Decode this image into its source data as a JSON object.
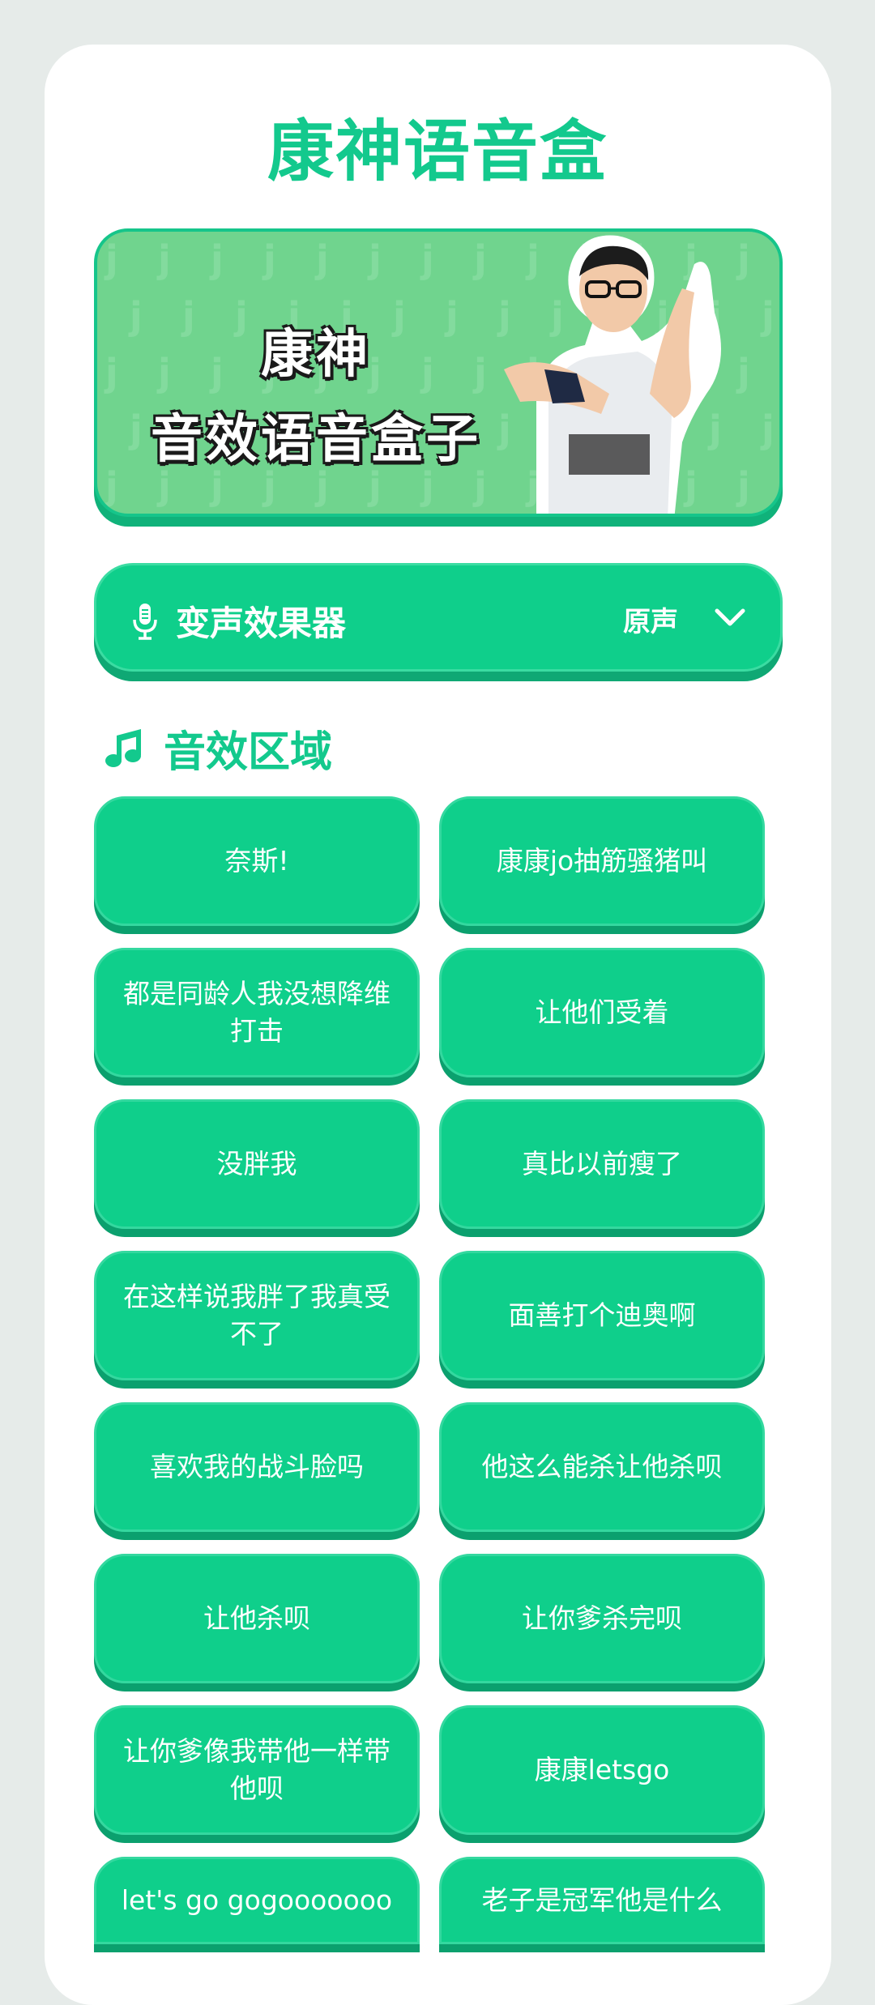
{
  "app": {
    "title": "康神语音盒"
  },
  "banner": {
    "line1": "康神",
    "line2": "音效语音盒子"
  },
  "voice_changer": {
    "label": "变声效果器",
    "value": "原声",
    "icon": "microphone-icon",
    "dropdown_icon": "chevron-down-icon"
  },
  "section": {
    "label": "音效区域",
    "icon": "music-note-icon"
  },
  "colors": {
    "accent": "#13c98d",
    "button": "#0fcf8b",
    "banner": "#70d48e"
  },
  "sounds": [
    "奈斯!",
    "康康jo抽筋骚猪叫",
    "都是同龄人我没想降维打击",
    "让他们受着",
    "没胖我",
    "真比以前瘦了",
    "在这样说我胖了我真受不了",
    "面善打个迪奥啊",
    "喜欢我的战斗脸吗",
    "他这么能杀让他杀呗",
    "让他杀呗",
    "让你爹杀完呗",
    "让你爹像我带他一样带他呗",
    "康康letsgo",
    "let's go gogooooooo",
    "老子是冠军他是什么"
  ]
}
